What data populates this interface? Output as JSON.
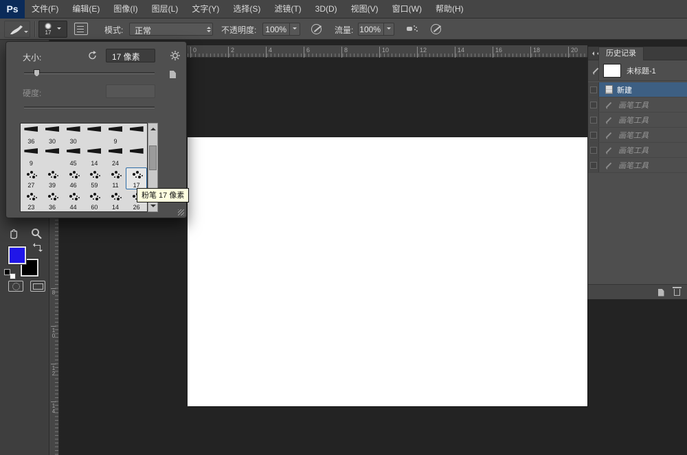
{
  "app": {
    "logo": "Ps"
  },
  "menu": {
    "items": [
      "文件(F)",
      "编辑(E)",
      "图像(I)",
      "图层(L)",
      "文字(Y)",
      "选择(S)",
      "滤镜(T)",
      "3D(D)",
      "视图(V)",
      "窗口(W)",
      "帮助(H)"
    ]
  },
  "options": {
    "brush_preview_size": "17",
    "mode_label": "模式:",
    "mode_value": "正常",
    "opacity_label": "不透明度:",
    "opacity_value": "100%",
    "flow_label": "流量:",
    "flow_value": "100%"
  },
  "brush_picker": {
    "size_label": "大小:",
    "size_value": "17 像素",
    "hardness_label": "硬度:",
    "tooltip": "粉笔 17 像素",
    "brushes": [
      {
        "size": "36",
        "icon": "stroke-brush-icon"
      },
      {
        "size": "30",
        "icon": "stroke-brush-icon"
      },
      {
        "size": "30",
        "icon": "stroke-brush-icon"
      },
      {
        "size": "",
        "icon": "stroke-brush-icon"
      },
      {
        "size": "9",
        "icon": "stroke-brush-icon"
      },
      {
        "size": "",
        "icon": "stroke-brush-icon"
      },
      {
        "size": "9",
        "icon": "stroke-brush-icon"
      },
      {
        "size": "",
        "icon": "stroke-brush-icon"
      },
      {
        "size": "45",
        "icon": "stroke-brush-icon"
      },
      {
        "size": "14",
        "icon": "stroke-brush-icon"
      },
      {
        "size": "24",
        "icon": "stroke-brush-icon"
      },
      {
        "size": "",
        "icon": "stroke-brush-icon"
      },
      {
        "size": "27",
        "icon": "spatter-brush-icon"
      },
      {
        "size": "39",
        "icon": "spatter-brush-icon"
      },
      {
        "size": "46",
        "icon": "spatter-brush-icon"
      },
      {
        "size": "59",
        "icon": "spatter-brush-icon"
      },
      {
        "size": "11",
        "icon": "spatter-brush-icon"
      },
      {
        "size": "17",
        "icon": "spatter-brush-icon",
        "selected": true
      },
      {
        "size": "23",
        "icon": "spatter-brush-icon"
      },
      {
        "size": "36",
        "icon": "spatter-brush-icon"
      },
      {
        "size": "44",
        "icon": "spatter-brush-icon"
      },
      {
        "size": "60",
        "icon": "spatter-brush-icon"
      },
      {
        "size": "14",
        "icon": "spatter-brush-icon"
      },
      {
        "size": "26",
        "icon": "spatter-brush-icon"
      }
    ]
  },
  "rulers": {
    "top": [
      "0",
      "2",
      "4",
      "6",
      "8",
      "10",
      "12",
      "14",
      "16",
      "18",
      "20"
    ],
    "left": [
      "8",
      "10",
      "12",
      "14"
    ]
  },
  "history": {
    "title": "历史记录",
    "snapshot_label": "未标题-1",
    "entries": [
      {
        "label": "新建",
        "icon": "new-document-icon",
        "state": "selected"
      },
      {
        "label": "画笔工具",
        "icon": "brush-icon",
        "state": "undone"
      },
      {
        "label": "画笔工具",
        "icon": "brush-icon",
        "state": "undone"
      },
      {
        "label": "画笔工具",
        "icon": "brush-icon",
        "state": "undone"
      },
      {
        "label": "画笔工具",
        "icon": "brush-icon",
        "state": "undone"
      },
      {
        "label": "画笔工具",
        "icon": "brush-icon",
        "state": "undone"
      }
    ]
  },
  "colors": {
    "foreground_swatch": "#2016e8",
    "background_swatch": "#000000",
    "selection_blue": "#3d5f83",
    "tooltip_bg": "#ffffdf"
  }
}
